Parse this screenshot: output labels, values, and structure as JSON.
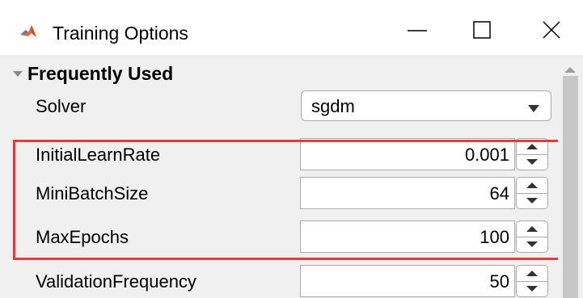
{
  "window": {
    "title": "Training Options",
    "controls": {
      "minimize": "minimize",
      "maximize": "maximize",
      "close": "close"
    }
  },
  "section": {
    "title": "Frequently Used",
    "expanded": true
  },
  "fields": {
    "solver": {
      "label": "Solver",
      "value": "sgdm"
    },
    "initial_learn_rate": {
      "label": "InitialLearnRate",
      "value": "0.001"
    },
    "mini_batch_size": {
      "label": "MiniBatchSize",
      "value": "64"
    },
    "max_epochs": {
      "label": "MaxEpochs",
      "value": "100"
    },
    "validation_frequency": {
      "label": "ValidationFrequency",
      "value": "50"
    }
  },
  "icons": {
    "app": "matlab-icon",
    "section_toggle": "triangle-down-icon",
    "dropdown": "chevron-down-icon",
    "spinner_up": "triangle-up-icon",
    "spinner_down": "triangle-down-icon",
    "scroll_up": "scroll-up-arrow-icon"
  },
  "colors": {
    "highlight": "#e8393d",
    "panel_background": "#f0f0f0",
    "titlebar_background": "#ffffff"
  }
}
